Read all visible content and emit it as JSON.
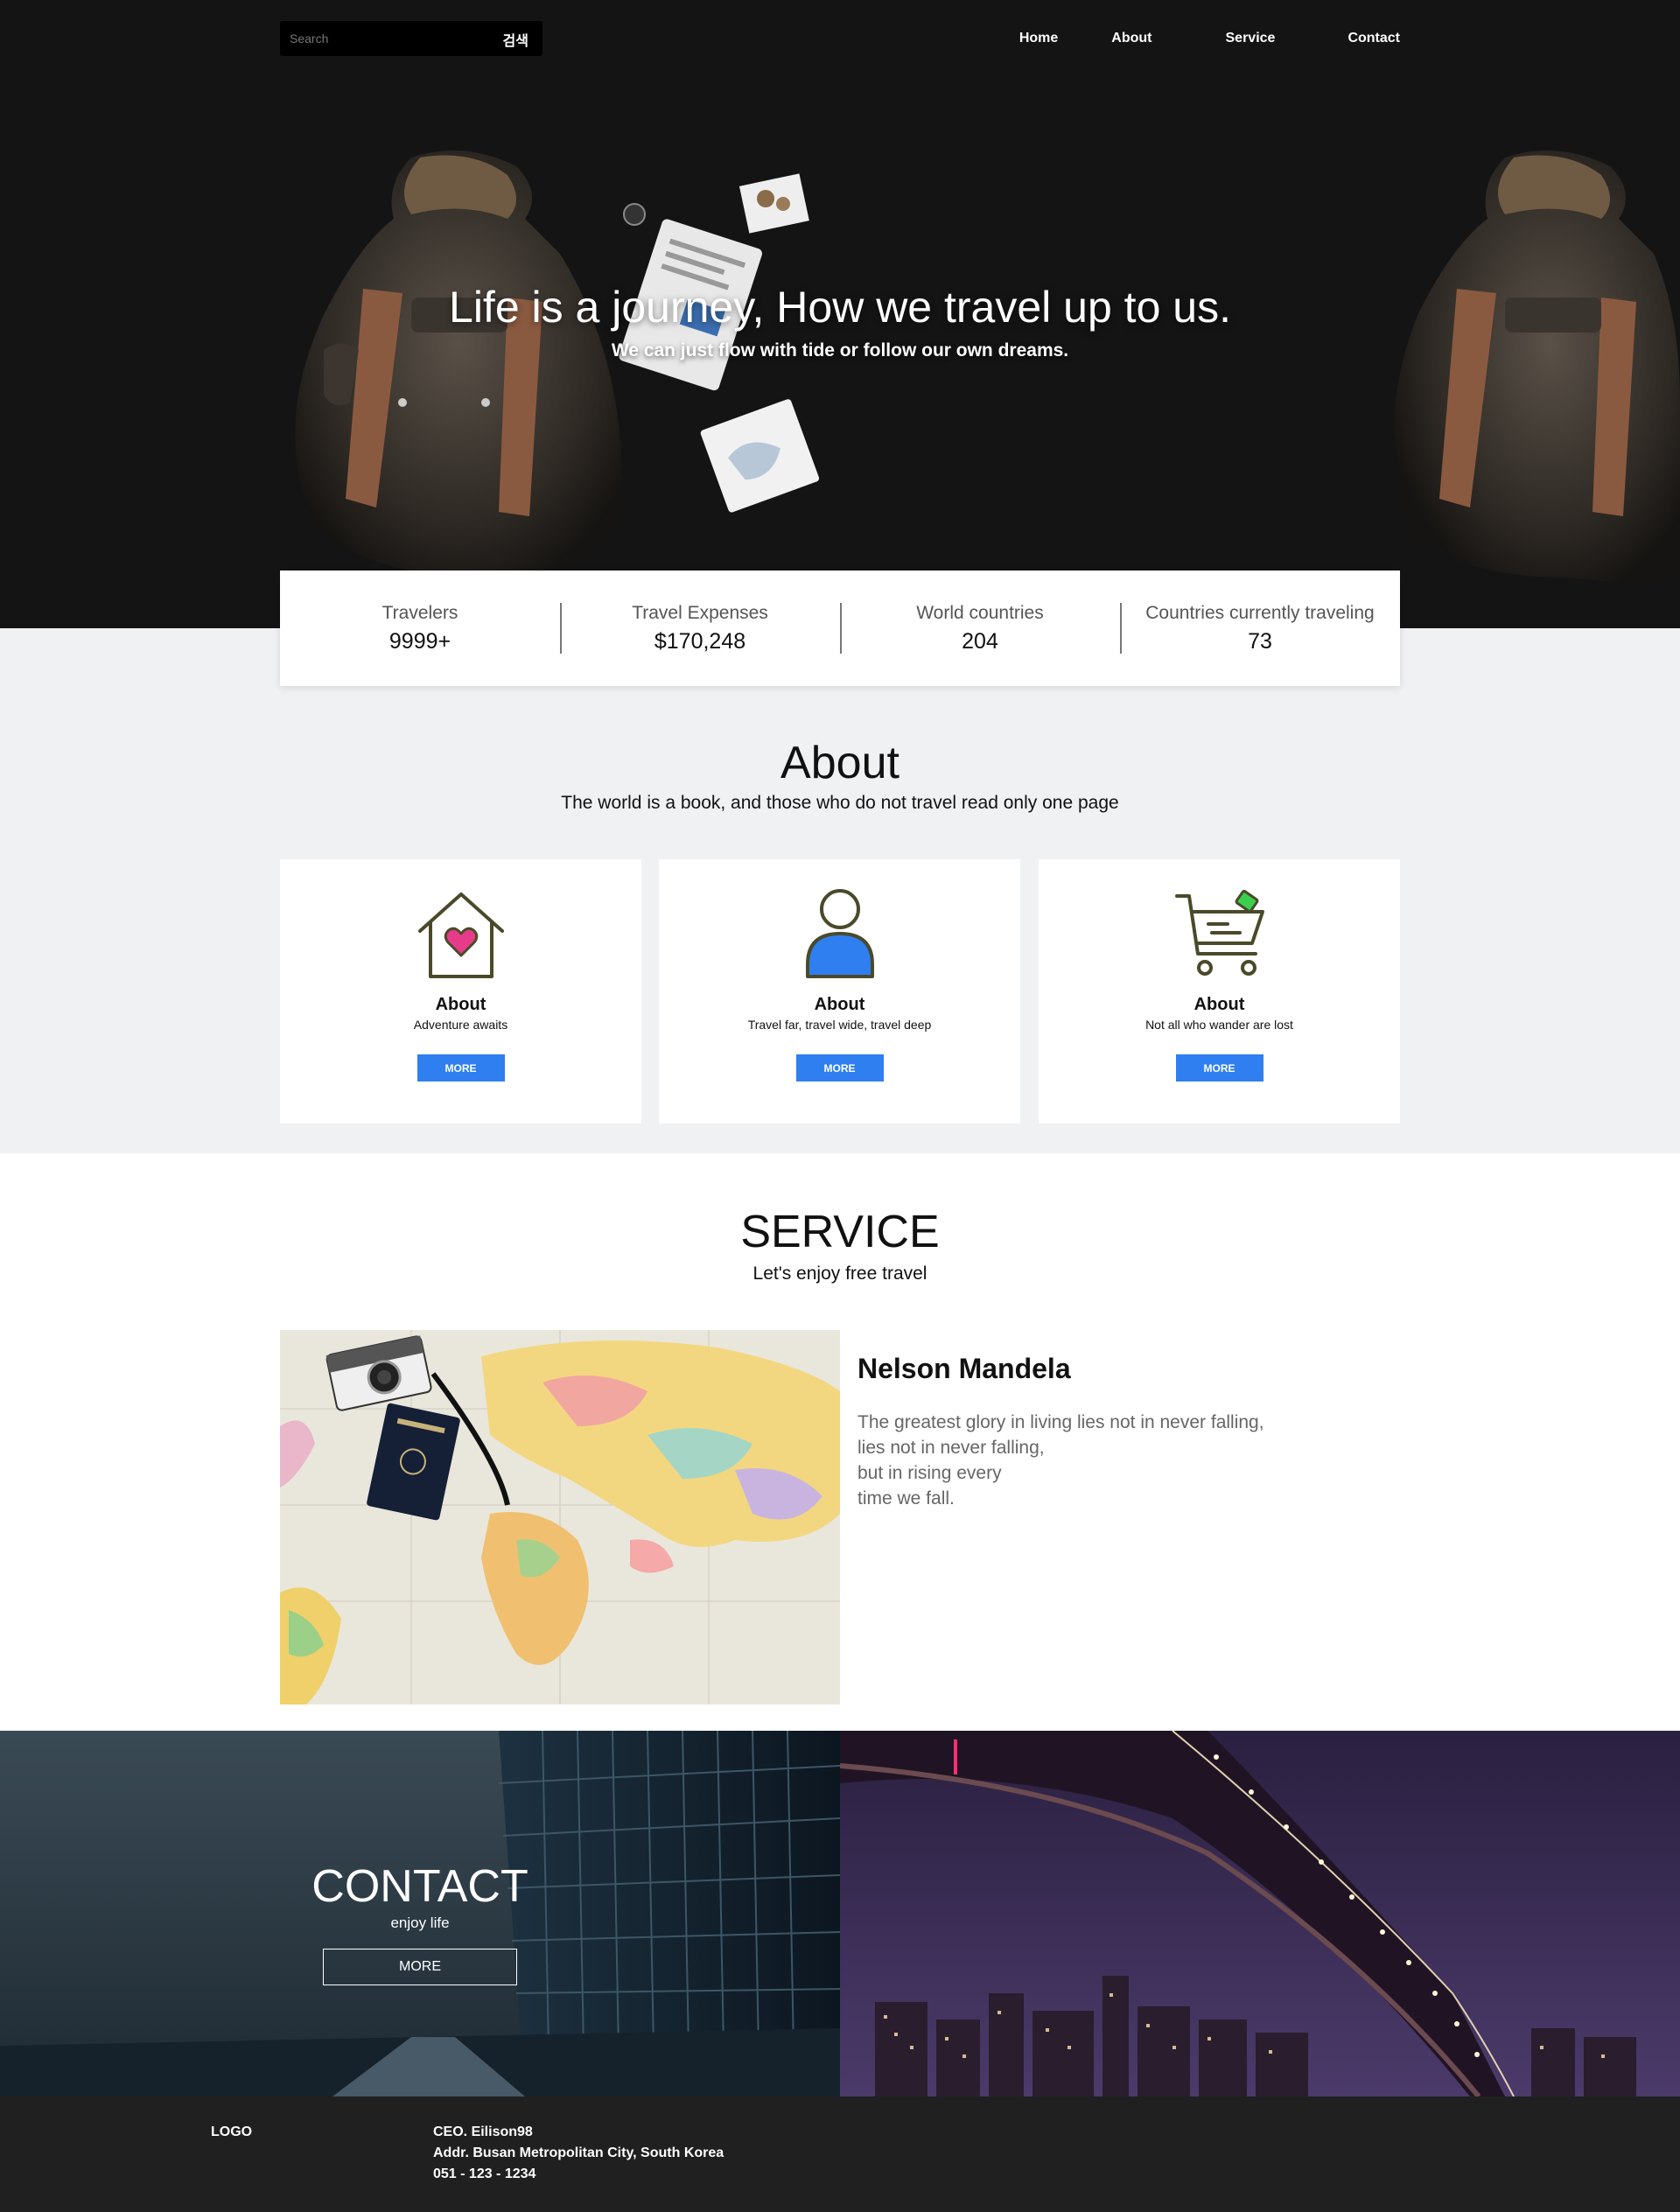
{
  "header": {
    "search_placeholder": "Search",
    "search_button": "검색",
    "nav": [
      "Home",
      "About",
      "Service",
      "Contact"
    ]
  },
  "hero": {
    "title": "Life is a journey, How we travel up to us.",
    "subtitle": "We can just flow with tide or follow our own dreams."
  },
  "stats": [
    {
      "label": "Travelers",
      "value": "9999+"
    },
    {
      "label": "Travel Expenses",
      "value": "$170,248"
    },
    {
      "label": "World countries",
      "value": "204"
    },
    {
      "label": "Countries currently traveling",
      "value": "73"
    }
  ],
  "about": {
    "title": "About",
    "subtitle": "The world is a book, and those who do not travel read only one page",
    "cards": [
      {
        "icon": "house-heart-icon",
        "title": "About",
        "text": "Adventure awaits",
        "button": "MORE"
      },
      {
        "icon": "person-icon",
        "title": "About",
        "text": "Travel far, travel wide, travel deep",
        "button": "MORE"
      },
      {
        "icon": "shopping-cart-icon",
        "title": "About",
        "text": "Not all who wander are lost",
        "button": "MORE"
      }
    ]
  },
  "service": {
    "title": "SERVICE",
    "subtitle": "Let's enjoy free travel",
    "quote_author": "Nelson Mandela",
    "quote_lines": [
      "The greatest glory in living lies not in never falling,",
      "lies not in never falling,",
      "but in rising every",
      "time we fall."
    ]
  },
  "contact": {
    "title": "CONTACT",
    "subtitle": "enjoy life",
    "button": "MORE"
  },
  "footer": {
    "logo": "LOGO",
    "ceo": "CEO. Eilison98",
    "address": "Addr. Busan Metropolitan City, South Korea",
    "phone": "051 - 123 - 1234"
  },
  "colors": {
    "accent": "#2f7ff0",
    "hero_bg": "#141414",
    "section_bg": "#f0f1f3",
    "footer_bg": "#202020"
  }
}
